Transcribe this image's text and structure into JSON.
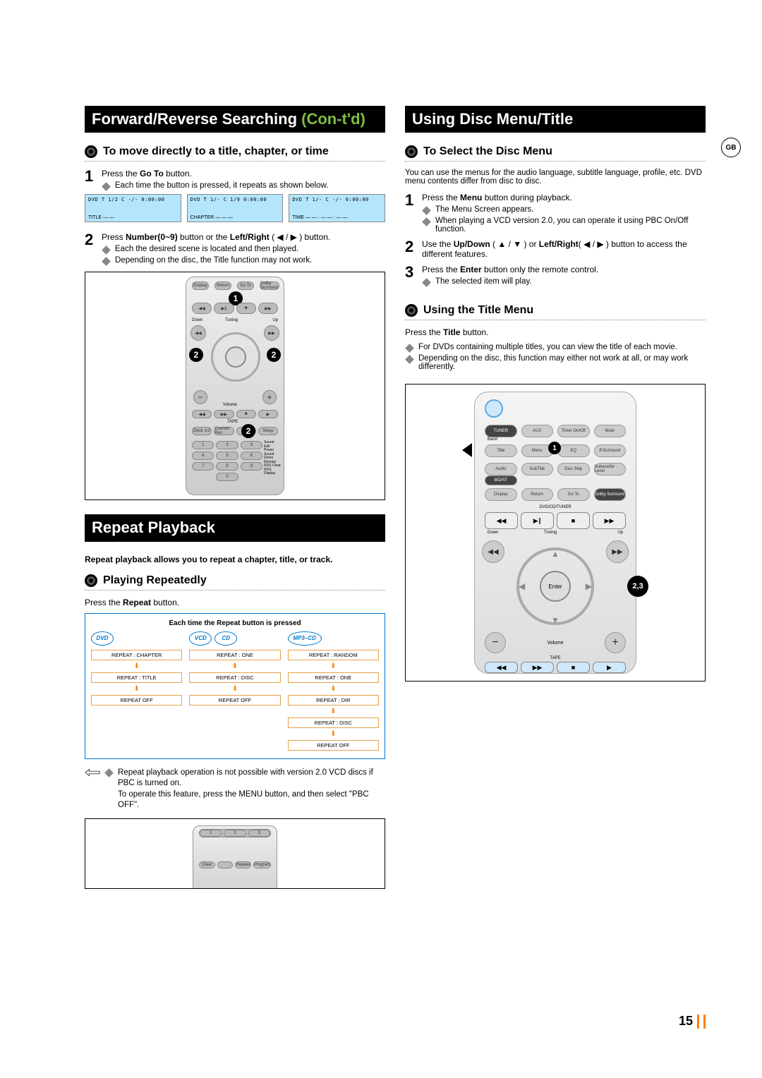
{
  "page_number": "15",
  "lang_tag": "GB",
  "left": {
    "section1_title_a": "Forward/Reverse Searching ",
    "section1_title_b": "(Con-t'd)",
    "sub1": "To move directly to a title, chapter, or time",
    "step1_text_a": "Press the ",
    "step1_text_b": "Go To",
    "step1_text_c": " button.",
    "step1_bullet": "Each time the button is pressed, it repeats as shown below.",
    "lcd1_label": "TITLE — —",
    "lcd2_label": "CHAPTER — — —",
    "lcd3_label": "TIME — — : — — : — —",
    "lcd_top": "DVD   T 1/2   C -/-   0:00:00",
    "lcd_top2": "DVD   T 1/-   C 1/9   0:00:00",
    "lcd_top3": "DVD   T 1/-   C -/-   0:00:00",
    "step2_text_a": "Press ",
    "step2_text_b": "Number(0~9)",
    "step2_text_c": " button or the ",
    "step2_text_d": "Left/Right",
    "step2_text_e": " ( ◀ / ▶ ) button.",
    "step2_bullet1": "Each the desired scene is located and then played.",
    "step2_bullet2": "Depending on the disc, the Title function may not work.",
    "remote_badges": [
      "1",
      "2",
      "2",
      "2"
    ],
    "remote_row_labels": [
      "Display",
      "Return",
      "Go To",
      "Dolby Surround"
    ],
    "remote_tuning_down": "Down",
    "remote_tuning": "Tuning",
    "remote_tuning_up": "Up",
    "remote_volume": "Volume",
    "remote_tape": "TAPE",
    "remote_bottom_row": [
      "Deck 1/2",
      "Counter Res",
      "",
      "Sleep"
    ],
    "remote_side_labels": [
      "Sound Edit",
      "Power Sound",
      "Demo",
      "Remain",
      "RDS Clear",
      "RDS Display"
    ],
    "section2_title": "Repeat Playback",
    "intro": "Repeat playback allows you to repeat a chapter, title, or track.",
    "sub2": "Playing Repeatedly",
    "press_repeat_a": "Press the ",
    "press_repeat_b": "Repeat",
    "press_repeat_c": " button.",
    "diagram_header": "Each time the Repeat button is pressed",
    "discs": {
      "dvd": "DVD",
      "vcd": "VCD",
      "cd": "CD",
      "mp3cd": "MP3–CD"
    },
    "dvd_seq": [
      "REPEAT : CHAPTER",
      "REPEAT : TITLE",
      "REPEAT OFF"
    ],
    "vcd_seq": [
      "REPEAT : ONE",
      "REPEAT : DISC",
      "REPEAT OFF"
    ],
    "mp3_seq": [
      "REPEAT : RANDOM",
      "REPEAT : ONE",
      "REPEAT : DIR",
      "REPEAT : DISC",
      "REPEAT OFF"
    ],
    "note1": "Repeat playback operation is not possible with version 2.0 VCD discs if PBC is turned on.",
    "note2": "To operate this feature, press the MENU button, and then select \"PBC OFF\".",
    "remote_mini_labels": [
      "Clear",
      "",
      "Repeat",
      "Program"
    ]
  },
  "right": {
    "section_title": "Using Disc Menu/Title",
    "sub1": "To Select the Disc Menu",
    "sub1_intro": "You can use the menus for the audio language, subtitle language, profile, etc. DVD menu contents differ from disc to disc.",
    "step1_a": "Press the ",
    "step1_b": "Menu",
    "step1_c": " button during playback.",
    "step1_bullet1": "The Menu Screen appears.",
    "step1_bullet2": "When playing a VCD version 2.0, you can operate it using PBC On/Off function.",
    "step2_a": "Use the ",
    "step2_b": "Up/Down",
    "step2_c": " ( ▲ / ▼ ) or ",
    "step2_d": "Left/Right",
    "step2_e": "( ◀ / ▶ ) button to access the different features.",
    "step3_a": "Press the ",
    "step3_b": "Enter",
    "step3_c": " button only the remote control.",
    "step3_bullet": "The selected item will play.",
    "sub2": "Using the Title Menu",
    "press_title_a": "Press the ",
    "press_title_b": "Title",
    "press_title_c": " button.",
    "note1": "For DVDs containing multiple titles, you can view the title of each movie.",
    "note2": "Depending on the disc, this function may either not work at all, or may work differently.",
    "remote_rows": {
      "r1": [
        "TUNER",
        "AUX",
        "Timer On/Off",
        "Mute"
      ],
      "r1_sub": "Band",
      "r2": [
        "Title",
        "Menu",
        "EQ",
        "P.Surround"
      ],
      "r3": [
        "Audio",
        "SubTitle",
        "Disc Skip",
        "Subwoofer Level"
      ],
      "r3_sub": "MO/ST",
      "r4": [
        "Display",
        "Return",
        "Go To",
        "Dolby Surround"
      ]
    },
    "remote_section_label": "DVD/CD/TUNER",
    "remote_tuning_label": "Tuning",
    "remote_down": "Down",
    "remote_up": "Up",
    "remote_enter": "Enter",
    "remote_volume": "Volume",
    "remote_tape": "TAPE",
    "badge1": "1",
    "badge23": "2,3"
  }
}
